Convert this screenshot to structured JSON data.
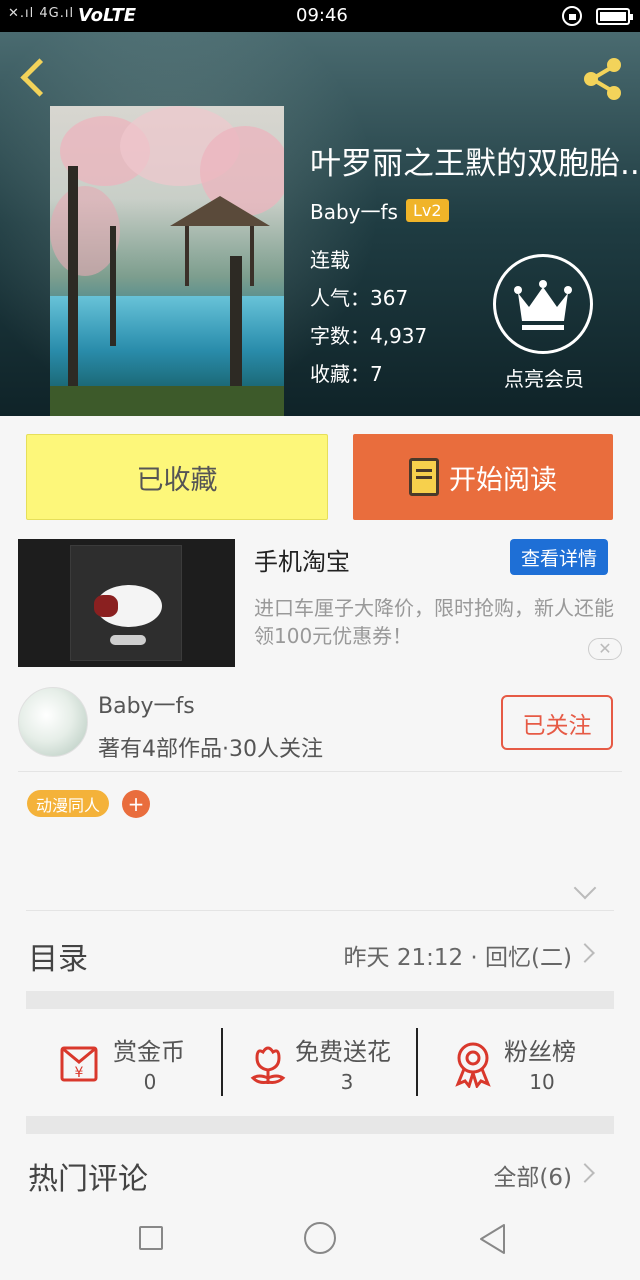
{
  "status_bar": {
    "signal": "4G",
    "network": "VoLTE",
    "time": "09:46"
  },
  "header": {
    "back_icon": "back-chevron-icon",
    "share_icon": "share-icon",
    "title": "叶罗丽之王默的双胞胎...",
    "author": "Baby一fs",
    "level": "Lv2",
    "status": "连载",
    "popularity": "人气：367",
    "word_count": "字数：4,937",
    "favorites": "收藏：7",
    "vip_label": "点亮会员",
    "vip_icon": "crown-icon"
  },
  "actions": {
    "collected_label": "已收藏",
    "read_label": "开始阅读",
    "read_icon": "book-icon"
  },
  "ad": {
    "title": "手机淘宝",
    "detail_button": "查看详情",
    "description": "进口车厘子大降价，限时抢购，新人还能领100元优惠券！",
    "close_icon": "close-icon"
  },
  "author_profile": {
    "name": "Baby一fs",
    "stats": "著有4部作品·30人关注",
    "follow_label": "已关注"
  },
  "tags": {
    "items": [
      "动漫同人"
    ],
    "add_label": "+"
  },
  "catalog": {
    "label": "目录",
    "latest": "昨天 21:12 · 回忆(二)"
  },
  "stats": [
    {
      "label": "赏金币",
      "value": "0",
      "icon": "red-envelope-icon",
      "color": "#d9382c"
    },
    {
      "label": "免费送花",
      "value": "3",
      "icon": "flower-icon",
      "color": "#d9382c"
    },
    {
      "label": "粉丝榜",
      "value": "10",
      "icon": "ribbon-medal-icon",
      "color": "#d9382c"
    }
  ],
  "comments": {
    "label": "热门评论",
    "all": "全部(6)"
  },
  "colors": {
    "accent_orange": "#e96d3d",
    "collected_yellow": "#fdf77a",
    "ad_blue": "#1e6fd6",
    "level_gold": "#f0b429",
    "follow_red": "#e65a45"
  }
}
